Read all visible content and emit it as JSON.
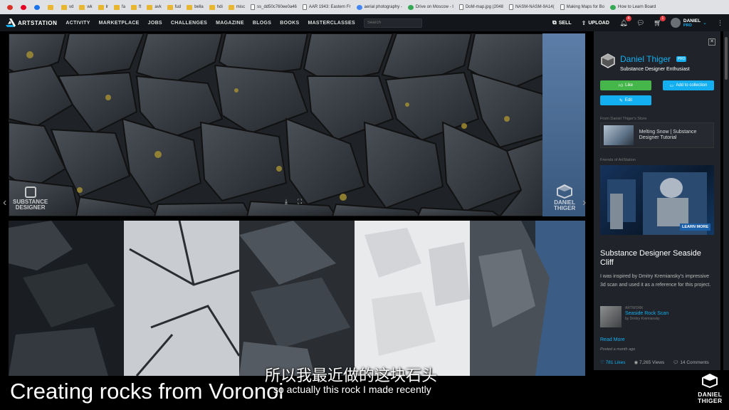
{
  "bookmarks": [
    {
      "label": "",
      "icon": "red-circle-icon"
    },
    {
      "label": "",
      "icon": "pinterest-icon"
    },
    {
      "label": "",
      "icon": "blue-circle-icon"
    },
    {
      "label": "",
      "icon": "folder-icon"
    },
    {
      "label": "vd",
      "icon": "folder-icon"
    },
    {
      "label": "wk",
      "icon": "folder-icon"
    },
    {
      "label": "lr",
      "icon": "folder-icon"
    },
    {
      "label": "fa",
      "icon": "folder-icon"
    },
    {
      "label": "ft",
      "icon": "folder-icon"
    },
    {
      "label": "avk",
      "icon": "folder-icon"
    },
    {
      "label": "fud",
      "icon": "folder-icon"
    },
    {
      "label": "bella",
      "icon": "folder-icon"
    },
    {
      "label": "hdi",
      "icon": "folder-icon"
    },
    {
      "label": "misc",
      "icon": "folder-icon"
    },
    {
      "label": "ss_dd50c760ee0a46",
      "icon": "page-icon"
    },
    {
      "label": "AAR 1943: Eastern Fr",
      "icon": "page-icon"
    },
    {
      "label": "aerial photography -",
      "icon": "google-icon"
    },
    {
      "label": "Drive on Moscow - I",
      "icon": "green-icon"
    },
    {
      "label": "DoM-map.jpg (2048",
      "icon": "page-icon"
    },
    {
      "label": "NASM-NASM-9A14(",
      "icon": "page-icon"
    },
    {
      "label": "Making Maps for Bo",
      "icon": "page-icon"
    },
    {
      "label": "How to Learn Board",
      "icon": "green-icon"
    }
  ],
  "nav": {
    "brand": "ARTSTATION",
    "items": [
      "ACTIVITY",
      "MARKETPLACE",
      "JOBS",
      "CHALLENGES",
      "MAGAZINE",
      "BLOGS",
      "BOOKS",
      "MASTERCLASSES"
    ],
    "search_placeholder": "Search",
    "sell": "SELL",
    "upload": "UPLOAD",
    "notifications_count": "4",
    "cart_count": "1",
    "user_name": "DANIEL",
    "user_tier": "PRO"
  },
  "main": {
    "watermark_left": "SUBSTANCE\nDESIGNER",
    "watermark_right": "DANIEL\nTHIGER"
  },
  "panel": {
    "author_name": "Daniel Thiger",
    "author_badge": "PRO",
    "author_title": "Substance Designer Enthusiast",
    "like_label": "Like",
    "collection_label": "Add to collection",
    "edit_label": "Edit",
    "store_label": "From Daniel Thiger's Store",
    "store_item": "Melting Snow | Substance Designer Tutorial",
    "friends_label": "Friends of ArtStation",
    "ad_button": "LEARN MORE",
    "artwork_title": "Substance Designer Seaside Cliff",
    "artwork_desc": "I was inspired by Dmitry Kremiansky's impressive 3d scan and used it as a reference for this project.",
    "linked_type": "ARTWORK",
    "linked_name": "Seaside Rock Scan",
    "linked_by": "by Dmitry Kremiansky",
    "read_more": "Read More",
    "posted": "Posted a month ago",
    "likes": "781 Likes",
    "views": "7,265 Views",
    "comments": "14 Comments"
  },
  "overlay": {
    "subtitle_cn": "所以我最近做的这块石头",
    "subtitle_en": "so actually this rock I made recently",
    "caption": "Creating rocks from Voronoi",
    "corner_name_1": "DANIEL",
    "corner_name_2": "THIGER"
  },
  "colors": {
    "accent": "#13aff0",
    "like": "#45b649",
    "nav_bg": "#13161a",
    "panel_bg": "#202329"
  }
}
